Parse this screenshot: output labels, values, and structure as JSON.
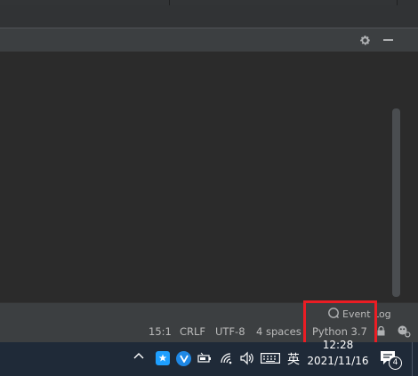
{
  "status_bar": {
    "position": "15:1",
    "line_separator": "CRLF",
    "encoding": "UTF-8",
    "indent": "4 spaces",
    "interpreter": "Python 3.7"
  },
  "event_log": {
    "label": "Event Log"
  },
  "taskbar": {
    "ime_label": "英",
    "time": "12:28",
    "date": "2021/11/16",
    "notification_count": "4"
  },
  "colors": {
    "highlight_box": "#ea1d24",
    "ide_background": "#2b2b2b",
    "panel_background": "#3c3f41",
    "taskbar_background": "#1f2a38"
  },
  "icons": [
    "gear-icon",
    "minimize-icon",
    "event-log-icon",
    "lock-icon",
    "inspector-icon",
    "chevron-up-icon",
    "app-star-icon",
    "app-v-icon",
    "battery-icon",
    "wifi-icon",
    "volume-icon",
    "keyboard-icon",
    "notification-icon"
  ]
}
